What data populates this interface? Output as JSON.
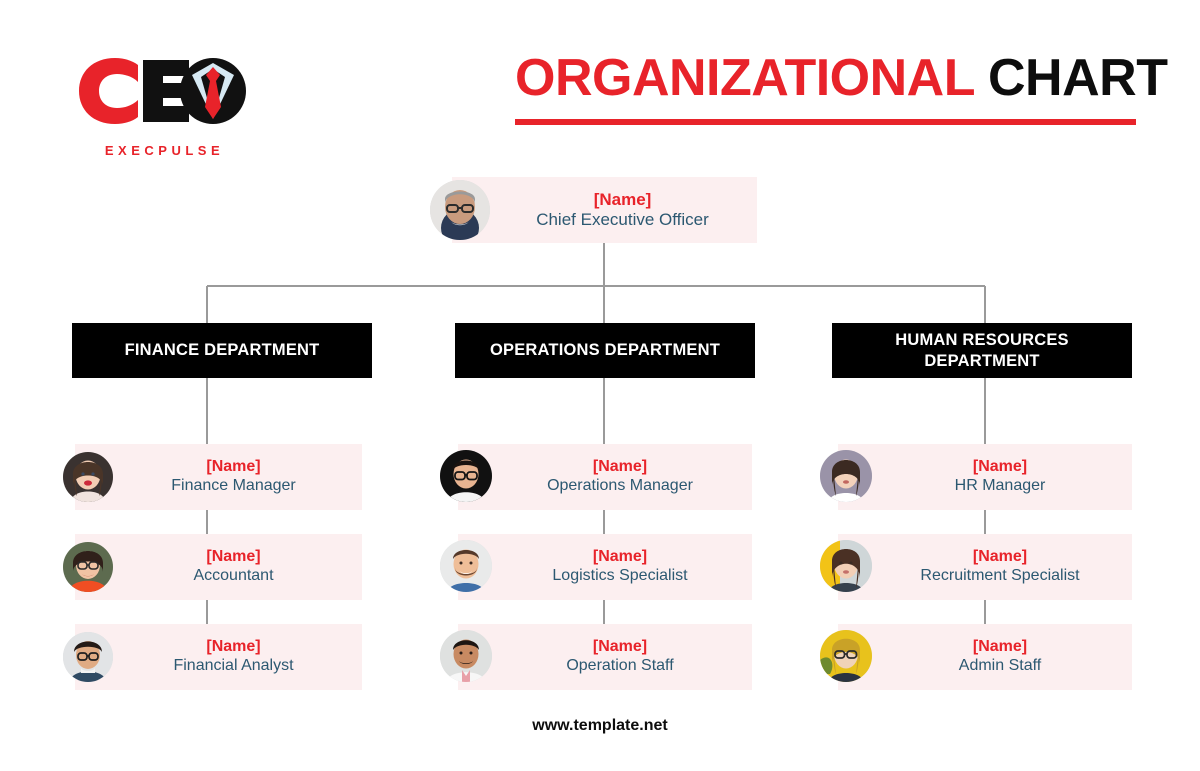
{
  "brand": {
    "logo_primary": "CEO",
    "logo_wordmark": "EXECPULSE",
    "logo_icon": "ceo-suit-tie-logo",
    "accent_red": "#E8232A",
    "card_pink": "#FCEFF0",
    "role_blue": "#2C5871",
    "bar_black": "#000000"
  },
  "header": {
    "title_part1": "ORGANIZATIONAL",
    "title_part2": "CHART"
  },
  "chart_data": {
    "type": "diagram",
    "title": "ORGANIZATIONAL CHART",
    "root": {
      "name": "[Name]",
      "role": "Chief Executive Officer",
      "avatar": "man-with-glasses-gray-beard"
    },
    "departments": [
      {
        "label": "FINANCE DEPARTMENT",
        "members": [
          {
            "name": "[Name]",
            "role": "Finance Manager",
            "avatar": "woman-dark-hair-red-lipstick"
          },
          {
            "name": "[Name]",
            "role": "Accountant",
            "avatar": "woman-glasses-orange-scarf"
          },
          {
            "name": "[Name]",
            "role": "Financial Analyst",
            "avatar": "man-glasses-dark-hair"
          }
        ]
      },
      {
        "label": "OPERATIONS DEPARTMENT",
        "members": [
          {
            "name": "[Name]",
            "role": "Operations Manager",
            "avatar": "man-glasses-black-background"
          },
          {
            "name": "[Name]",
            "role": "Logistics Specialist",
            "avatar": "man-beard-smiling"
          },
          {
            "name": "[Name]",
            "role": "Operation Staff",
            "avatar": "man-short-beard-white-shirt"
          }
        ]
      },
      {
        "label": "HUMAN RESOURCES DEPARTMENT",
        "members": [
          {
            "name": "[Name]",
            "role": "HR Manager",
            "avatar": "woman-white-collar-shirt"
          },
          {
            "name": "[Name]",
            "role": "Recruitment Specialist",
            "avatar": "woman-long-brown-hair"
          },
          {
            "name": "[Name]",
            "role": "Admin Staff",
            "avatar": "woman-glasses-yellow-background"
          }
        ]
      }
    ]
  },
  "footer": {
    "website": "www.template.net"
  }
}
